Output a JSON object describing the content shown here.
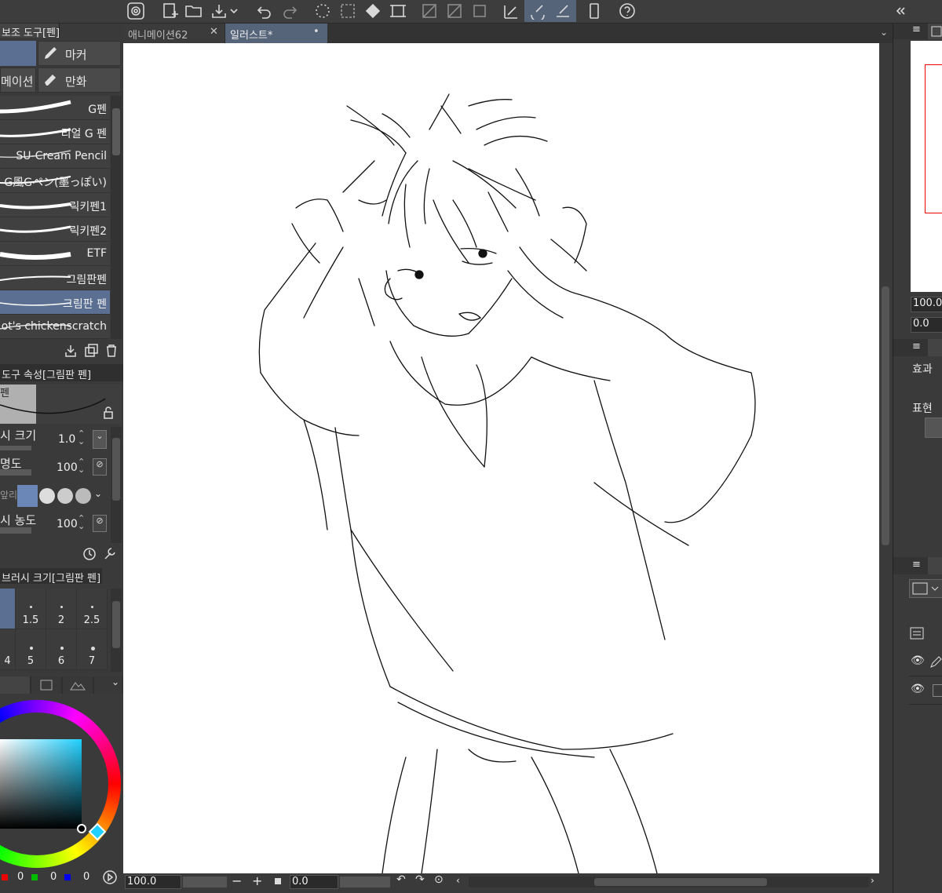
{
  "tabs": [
    {
      "label": "애니메이션62",
      "close": "✕"
    },
    {
      "label": "일러스트*",
      "close": "•"
    }
  ],
  "sub_tool": {
    "header": "보조 도구[펜]",
    "tabs": [
      {
        "label": ""
      },
      {
        "label": "마커"
      },
      {
        "label": "메이션"
      },
      {
        "label": "만화"
      }
    ]
  },
  "brushes": [
    "G펜",
    "리얼 G 펜",
    "SU-Cream Pencil",
    "G風Gペン(墨っぽい)",
    "릭키펜1",
    "릭키펜2",
    "ETF",
    "그림판펜",
    "그림판 펜",
    "ot's chickenscratch"
  ],
  "tool_prop": {
    "header": "도구 속성[그림판 펜]",
    "preview_label": "펜",
    "rows": [
      {
        "label": "시 크기",
        "value": "1.0"
      },
      {
        "label": "명도",
        "value": "100"
      },
      {
        "label": "앞리"
      },
      {
        "label": "시 농도",
        "value": "100"
      }
    ]
  },
  "brush_size": {
    "header": "브러시 크기[그림판 펜]",
    "sizes": [
      "",
      "1.5",
      "2",
      "2.5",
      "4",
      "5",
      "6",
      "7"
    ]
  },
  "color": {
    "values": [
      "0",
      "0",
      "0"
    ],
    "accent": "#6b87b8"
  },
  "canvas": {
    "zoom": "100.0",
    "rotation": "0.0",
    "minus": "−",
    "plus": "+"
  },
  "navigator": {
    "zoom": "100.0",
    "rotation": "0.0"
  },
  "right_panel": {
    "effect_label": "효과",
    "express_label": "표현"
  }
}
